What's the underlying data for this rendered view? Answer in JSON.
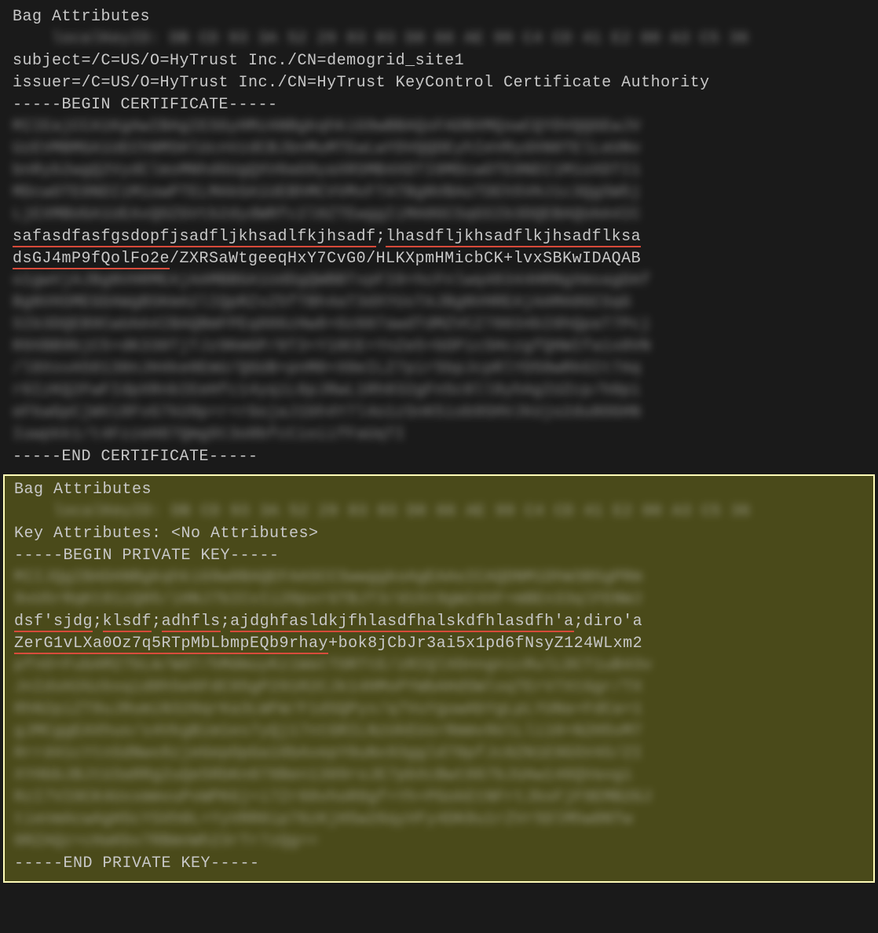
{
  "cert": {
    "bag_header": "Bag Attributes",
    "local_key_label": "localKeyID:",
    "local_key_value": "DB CD 93 3A 52 29 83 03 D0 66 AE 99 C4 CD 41 E2 00 A3 C5 36",
    "subject": "subject=/C=US/O=HyTrust Inc./CN=demogrid_site1",
    "issuer": "issuer=/C=US/O=HyTrust Inc./CN=HyTrust KeyControl Certificate Authority",
    "begin": "-----BEGIN CERTIFICATE-----",
    "blurred_lines_top": [
      "MIIEajCCA1KgAwIBAgIESGyHMzANBgkqhkiG9wBBAQsFADBXMQswCQYDVQQGEwJV",
      "UzEVMBMGA1UEChNMSHlUcnVzdCBJbnMuMTEwLwYDVQQDEyhIeVRydXN0TElLeUNv",
      "bnRyb2wgQ2VydClmsMNhdGUgQXV0aG9yaXRSMB4XDTI0MDcwOTE0NDI1M1oXDTI1",
      "MDcwOTE0NDI1M1owPTELMAkGA1UEBhMCVVMxFTATBgNVBAoTDEh5VHJ1c3QgSW5j",
      "LjEXMBUGA1UEAxQOZGVtb2dydWRfc2l0ZTEwggIiMA0GCSqGSIb3DQEBAQUAA4IC"
    ],
    "red1": "safasdfasfgsdopfjsadfljkhsadlfkjhsadf",
    "sep1": ";",
    "red2": "lhasdfljkhsadflkjhsadflksa",
    "red3": "dsGJ4mP9fQolFo2e",
    "clear_rest": "/ZXRSaWtgeeqHxY7CvG0/HLKXpmHMicbCK+lvxSBKwIDAQAB",
    "blurred_lines_mid": [
      "o1gwVjAJBgNVHRMEAjAAMBBGA1UdDgQWBBTxpFI0+hcFnlwq48344HRNgXmsagDAf",
      "BgNVHSMEGDAWgBSKmA2lIQpRZxZ5fTBh4aT3dXYUsTAJBgNVHREAjAAMA0GCSqG",
      "SIb3DQEB9CwUAA4IBAQBmFPEq886zHw8+Oz607awdTdMZVCZ78034bI0hQpaT7Pcj",
      "R9XBB9bjC5+dK330TjTJz9KmGP/0T3+Y10CE+YnZe5+bDPicSHczgfQHWIfa1s0VN",
      "/l8XsvA58130nJH4ke0EmU/QGUB+pnM0+X0eILZ7pir5bpJcpRlYD50wRkGIt7Aq",
      "r6IzKQ2FwFIdpXRnbIEeHfc14yqiL6pJRwL1Rh832gFn5c0ll8yhAgIUZcp/h0pi",
      "eFkwGpCjWVi8FvG7kU9p+r+rGojaJ1bh4Y7l4o1zSnK5iob9SHVJkUjo2du0OGHN",
      "Iuwpkk1/t4FzzeH87Qmg9t3o0bfcCioiifFaUqTI"
    ],
    "end": "-----END CERTIFICATE-----"
  },
  "key": {
    "bag_header": "Bag Attributes",
    "local_key_label": "localKeyID:",
    "local_key_value": "DB CD 93 3A 52 29 83 03 D0 66 AE 99 C4 CD 41 E2 00 A3 C5 36",
    "key_attrs": "Key Attributes: <No Attributes>",
    "begin": "-----BEGIN PRIVATE KEY-----",
    "blurred_lines_top": [
      "MIIJQgIBADANBgkqhkiG9w0BAQEFAASCCSwwggkoAgEAAoICAQDNM1DhW3B5gPRm",
      "9vU5rRqKt81zQ05/iHNJ7bICvIi20pvrGTBJT3/d15t9gW24XF+mBEn33qlFENWJ"
    ],
    "red1": "dsf'sjdg",
    "sep": ";",
    "red2": "klsdf",
    "red3": "adhfls",
    "red4": "ajdghfasldkjfhlasdfhalskdfhlasdfh'a",
    "after_red": ";diro'a",
    "red5": "ZerG1vLXa0Oz7q5RTpMbLbmpEQb9rhay",
    "clear_rest": "+bok8jCbJr3ai5x1pd6fNsyZ124WLxm2",
    "blurred_lines_mid": [
      "pfnO+FubAM27bLm/Wd7/hMdmuyKziWatTORTtE/zRIQlXOnngnicRulLDCT1uB43v",
      "JnIdsH2Gzbsqid0h5e6FdC95gP291R2CJk14HMsPYWbAHdSWlsqTErV7XtGgr/TX",
      "RhN2piZT8uJRumiN320qrKa3LWFW/F1dSQPyx/q7VuYguwAbYgLpLYUNa+FdCa+1",
      "gJMCggEAXhuo/s4VkgBim1es7yQj17ntGRILNzUkEUsrRmmv9UlLli10+N2H5vM7",
      "Rrrd41cYtnSdNwv8zjeGepOpGa18bAvepY0uNx93ggld70pfJc0ZN1E9GSV4S/ZI",
      "XYHbbJBJtU3aRRg2uQe5RbKn078Ben1309roJE7pbXcBwt867bJUAw146QVaxgi",
      "RzI7VI0CK4UxxmmvuPvWPKGj+i7Zr60vhoR8gf+Yh+PGokEtNFrtJbsFjF9EMB2GJ",
      "tienmAcwAgHScYSXh0L+YyVRR0ip76zKjH5w26qyVFy4DK8u1rZVr5DlMhw0NTw",
      "0RZAQz+cHaKbv7RBmnWh23rTr7zQg=="
    ],
    "end": "-----END PRIVATE KEY-----"
  }
}
